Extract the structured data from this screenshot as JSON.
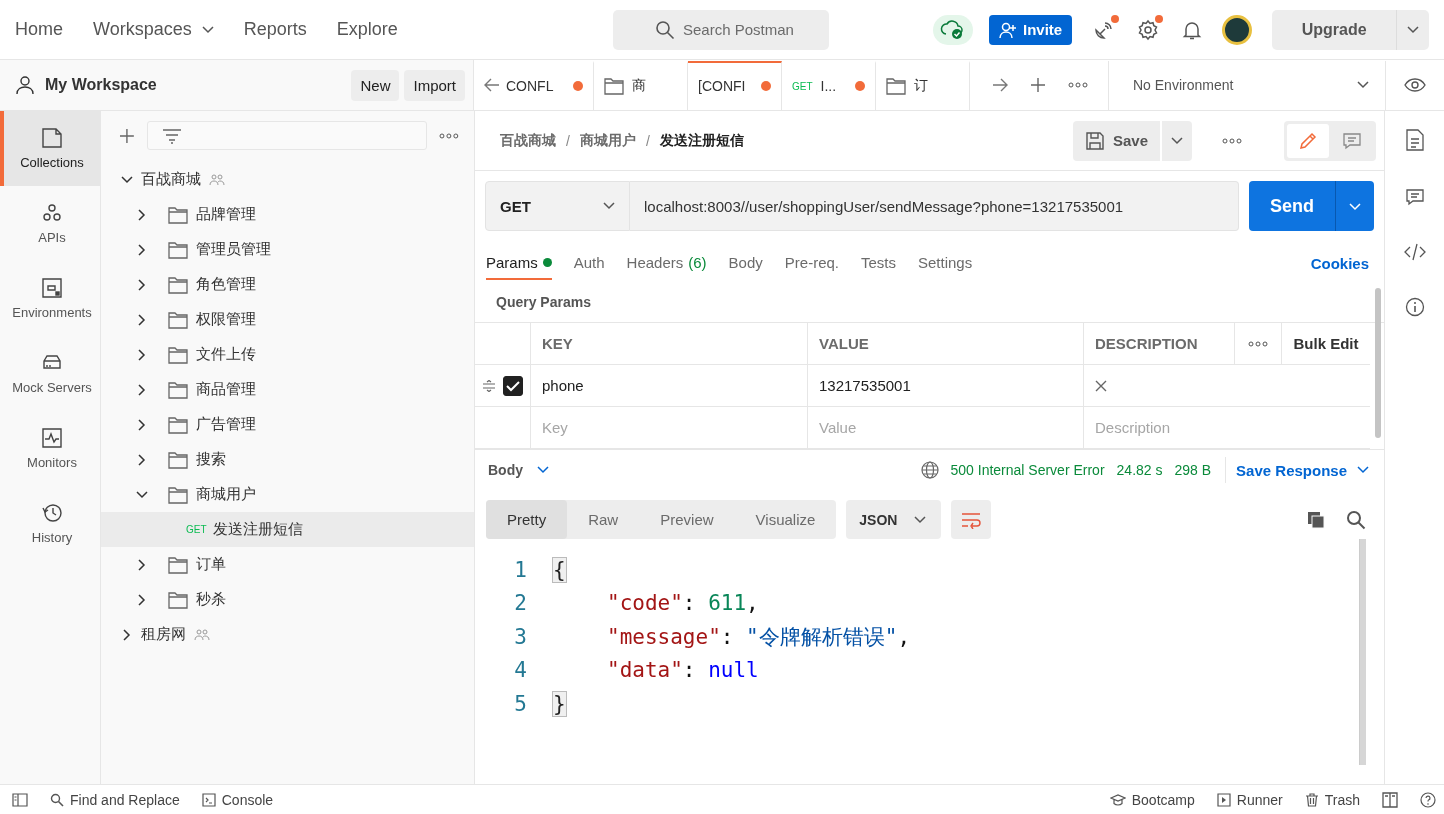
{
  "top_nav": [
    {
      "label": "Home",
      "has_menu": false
    },
    {
      "label": "Workspaces",
      "has_menu": true
    },
    {
      "label": "Reports",
      "has_menu": false
    },
    {
      "label": "Explore",
      "has_menu": false
    }
  ],
  "search": {
    "placeholder": "Search Postman"
  },
  "invite": "Invite",
  "header_icons": [
    {
      "kind": "satellite",
      "badge": true
    },
    {
      "kind": "settings",
      "badge": true
    },
    {
      "kind": "bell",
      "badge": false
    }
  ],
  "upgrade": "Upgrade",
  "workspace": {
    "name": "My Workspace",
    "buttons": [
      "New",
      "Import"
    ]
  },
  "tabs": [
    {
      "kind": "request",
      "label": "CONFL",
      "unsaved": true,
      "selected": false
    },
    {
      "kind": "folder",
      "label": "商",
      "unsaved": false,
      "selected": false
    },
    {
      "kind": "request",
      "label": "[CONFI",
      "unsaved": true,
      "selected": true
    },
    {
      "kind": "request",
      "method": "GET",
      "label": "I...",
      "unsaved": true,
      "selected": false
    },
    {
      "kind": "folder",
      "label": "订",
      "unsaved": false,
      "selected": false
    }
  ],
  "environment": "No Environment",
  "left_nav": [
    {
      "kind": "collections",
      "label": "Collections",
      "selected": true
    },
    {
      "kind": "apis",
      "label": "APIs",
      "selected": false
    },
    {
      "kind": "environments",
      "label": "Environments",
      "selected": false
    },
    {
      "kind": "mock",
      "label": "Mock Servers",
      "selected": false
    },
    {
      "kind": "monitors",
      "label": "Monitors",
      "selected": false
    },
    {
      "kind": "history",
      "label": "History",
      "selected": false
    }
  ],
  "tree": [
    {
      "kind": "collection",
      "name": "百战商城",
      "shared": true,
      "expanded": true,
      "selected": false,
      "children": [
        {
          "kind": "folder",
          "name": "品牌管理",
          "expanded": false,
          "selected": false
        },
        {
          "kind": "folder",
          "name": "管理员管理",
          "expanded": false,
          "selected": false
        },
        {
          "kind": "folder",
          "name": "角色管理",
          "expanded": false,
          "selected": false
        },
        {
          "kind": "folder",
          "name": "权限管理",
          "expanded": false,
          "selected": false
        },
        {
          "kind": "folder",
          "name": "文件上传",
          "expanded": false,
          "selected": false
        },
        {
          "kind": "folder",
          "name": "商品管理",
          "expanded": false,
          "selected": false
        },
        {
          "kind": "folder",
          "name": "广告管理",
          "expanded": false,
          "selected": false
        },
        {
          "kind": "folder",
          "name": "搜索",
          "expanded": false,
          "selected": false
        },
        {
          "kind": "folder",
          "name": "商城用户",
          "expanded": true,
          "selected": false,
          "children": [
            {
              "kind": "request",
              "method": "GET",
              "name": "发送注册短信",
              "selected": true
            }
          ]
        },
        {
          "kind": "folder",
          "name": "订单",
          "expanded": false,
          "selected": false
        },
        {
          "kind": "folder",
          "name": "秒杀",
          "expanded": false,
          "selected": false
        }
      ]
    },
    {
      "kind": "collection",
      "name": "租房网",
      "shared": true,
      "expanded": false,
      "selected": false
    }
  ],
  "breadcrumb": [
    {
      "label": "百战商城",
      "separator": "/"
    },
    {
      "label": "商城用户",
      "separator": "/"
    },
    {
      "label": "发送注册短信"
    }
  ],
  "modes": [
    {
      "kind": "edit",
      "selected": true
    },
    {
      "kind": "comment",
      "selected": false
    }
  ],
  "save": "Save",
  "request": {
    "method": "GET",
    "url": "localhost:8003//user/shoppingUser/sendMessage?phone=13217535001",
    "send": "Send"
  },
  "request_tabs": [
    {
      "label": "Params",
      "active_dot": true,
      "selected": true
    },
    {
      "label": "Auth",
      "selected": false
    },
    {
      "label": "Headers",
      "count": "(6)",
      "selected": false
    },
    {
      "label": "Body",
      "selected": false
    },
    {
      "label": "Pre-req.",
      "selected": false
    },
    {
      "label": "Tests",
      "selected": false
    },
    {
      "label": "Settings",
      "selected": false
    }
  ],
  "cookies": "Cookies",
  "query_params": {
    "title": "Query Params",
    "columns": [
      "KEY",
      "VALUE",
      "DESCRIPTION"
    ],
    "bulk_edit": "Bulk Edit",
    "rows": [
      {
        "key": "phone",
        "value": "13217535001",
        "checked": true
      }
    ],
    "placeholder": {
      "key": "Key",
      "value": "Value",
      "description": "Description"
    }
  },
  "response": {
    "label": "Body",
    "status": "500 Internal Server Error",
    "time": "24.82 s",
    "size": "298 B",
    "save": "Save Response",
    "views": [
      {
        "label": "Pretty",
        "selected": true
      },
      {
        "label": "Raw",
        "selected": false
      },
      {
        "label": "Preview",
        "selected": false
      },
      {
        "label": "Visualize",
        "selected": false
      }
    ],
    "format": "JSON",
    "lines": [
      {
        "number": "1",
        "tokens": [
          {
            "kind": "brace",
            "text": "{"
          }
        ]
      },
      {
        "number": "2",
        "tokens": [
          {
            "kind": "key",
            "text": "\"code\""
          },
          {
            "kind": "punct",
            "text": ": "
          },
          {
            "kind": "number",
            "text": "611"
          },
          {
            "kind": "punct",
            "text": ","
          }
        ]
      },
      {
        "number": "3",
        "tokens": [
          {
            "kind": "key",
            "text": "\"message\""
          },
          {
            "kind": "punct",
            "text": ": "
          },
          {
            "kind": "string",
            "text": "\"令牌解析错误\""
          },
          {
            "kind": "punct",
            "text": ","
          }
        ]
      },
      {
        "number": "4",
        "tokens": [
          {
            "kind": "key",
            "text": "\"data\""
          },
          {
            "kind": "punct",
            "text": ": "
          },
          {
            "kind": "null",
            "text": "null"
          }
        ]
      },
      {
        "number": "5",
        "tokens": [
          {
            "kind": "brace",
            "text": "}"
          }
        ]
      }
    ]
  },
  "status_bar": {
    "left": [
      {
        "kind": "find",
        "label": "Find and Replace"
      },
      {
        "kind": "console",
        "label": "Console"
      }
    ],
    "right": [
      {
        "kind": "bootcamp",
        "label": "Bootcamp"
      },
      {
        "kind": "runner",
        "label": "Runner"
      },
      {
        "kind": "trash",
        "label": "Trash"
      }
    ]
  }
}
